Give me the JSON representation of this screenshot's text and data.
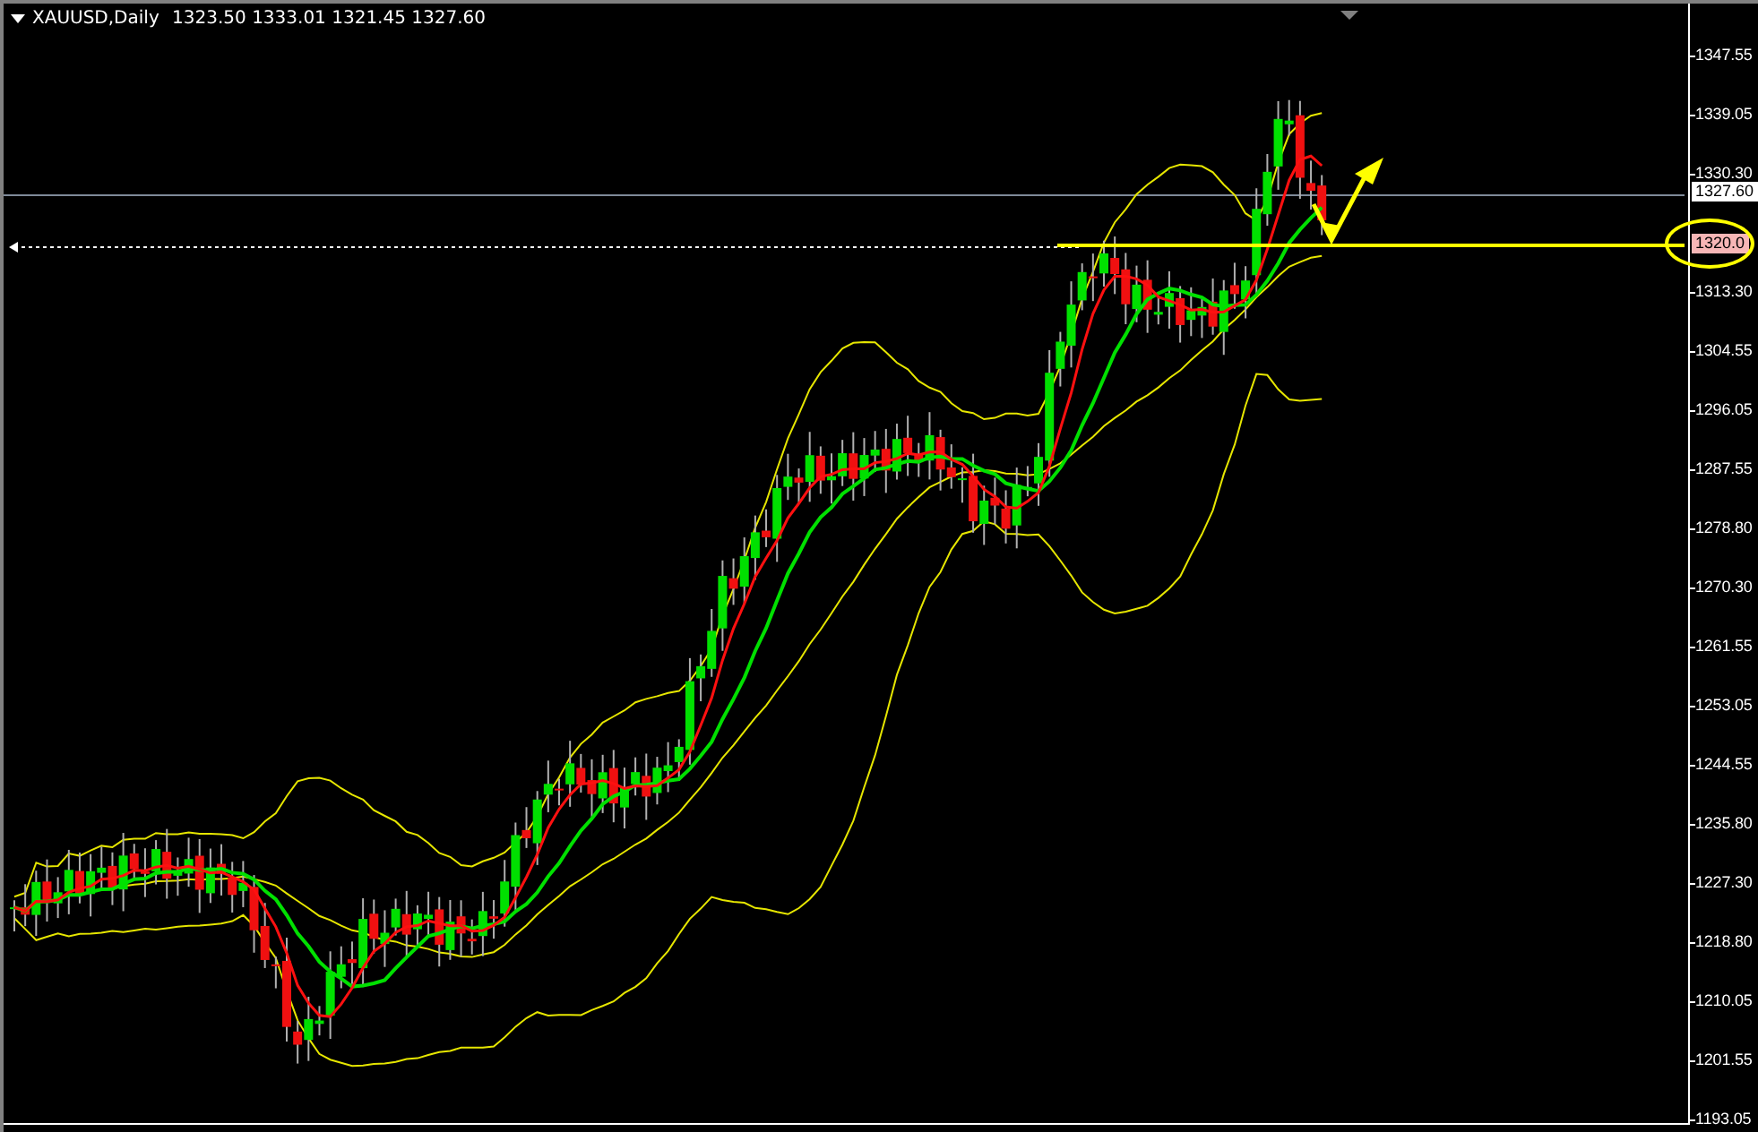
{
  "chart": {
    "symbol": "XAUUSD,Daily",
    "ohlc": "1323.50 1333.01 1321.45 1327.60",
    "price_axis": [
      "1347.55",
      "1339.05",
      "1330.30",
      "1313.30",
      "1304.55",
      "1296.05",
      "1287.55",
      "1278.80",
      "1270.30",
      "1261.55",
      "1253.05",
      "1244.55",
      "1235.80",
      "1227.30",
      "1218.80",
      "1210.05",
      "1201.55",
      "1193.05"
    ],
    "current_price": "1327.60",
    "line_price": "1320.0"
  }
}
